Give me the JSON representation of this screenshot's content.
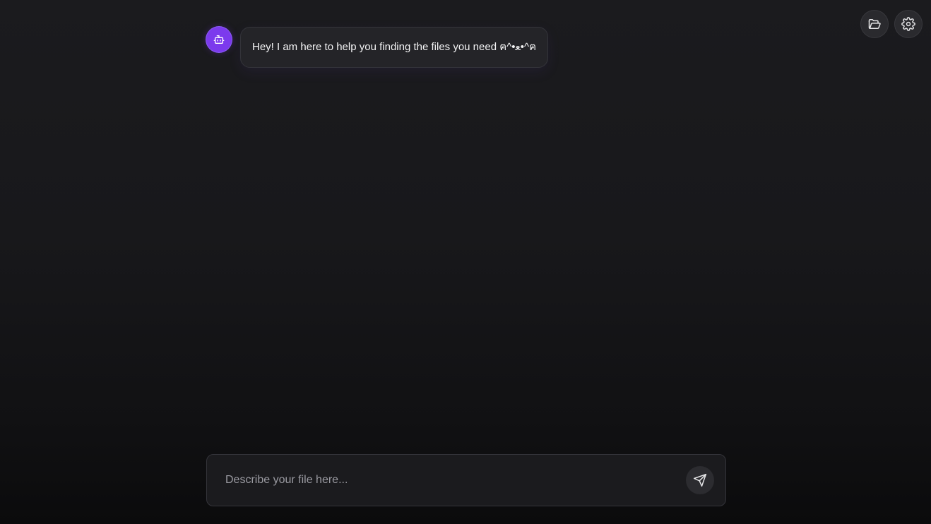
{
  "header": {
    "open_folder_icon": "folder-open-icon",
    "settings_icon": "gear-icon"
  },
  "chat": {
    "messages": [
      {
        "role": "assistant",
        "avatar_icon": "robot-icon",
        "text": "Hey! I am here to help you finding the files you need ฅ^•ﻌ•^ฅ"
      }
    ]
  },
  "composer": {
    "value": "",
    "placeholder": "Describe your file here...",
    "send_icon": "send-icon"
  },
  "colors": {
    "accent": "#7c3aed",
    "background": "#18181b",
    "bubble": "#242428"
  }
}
